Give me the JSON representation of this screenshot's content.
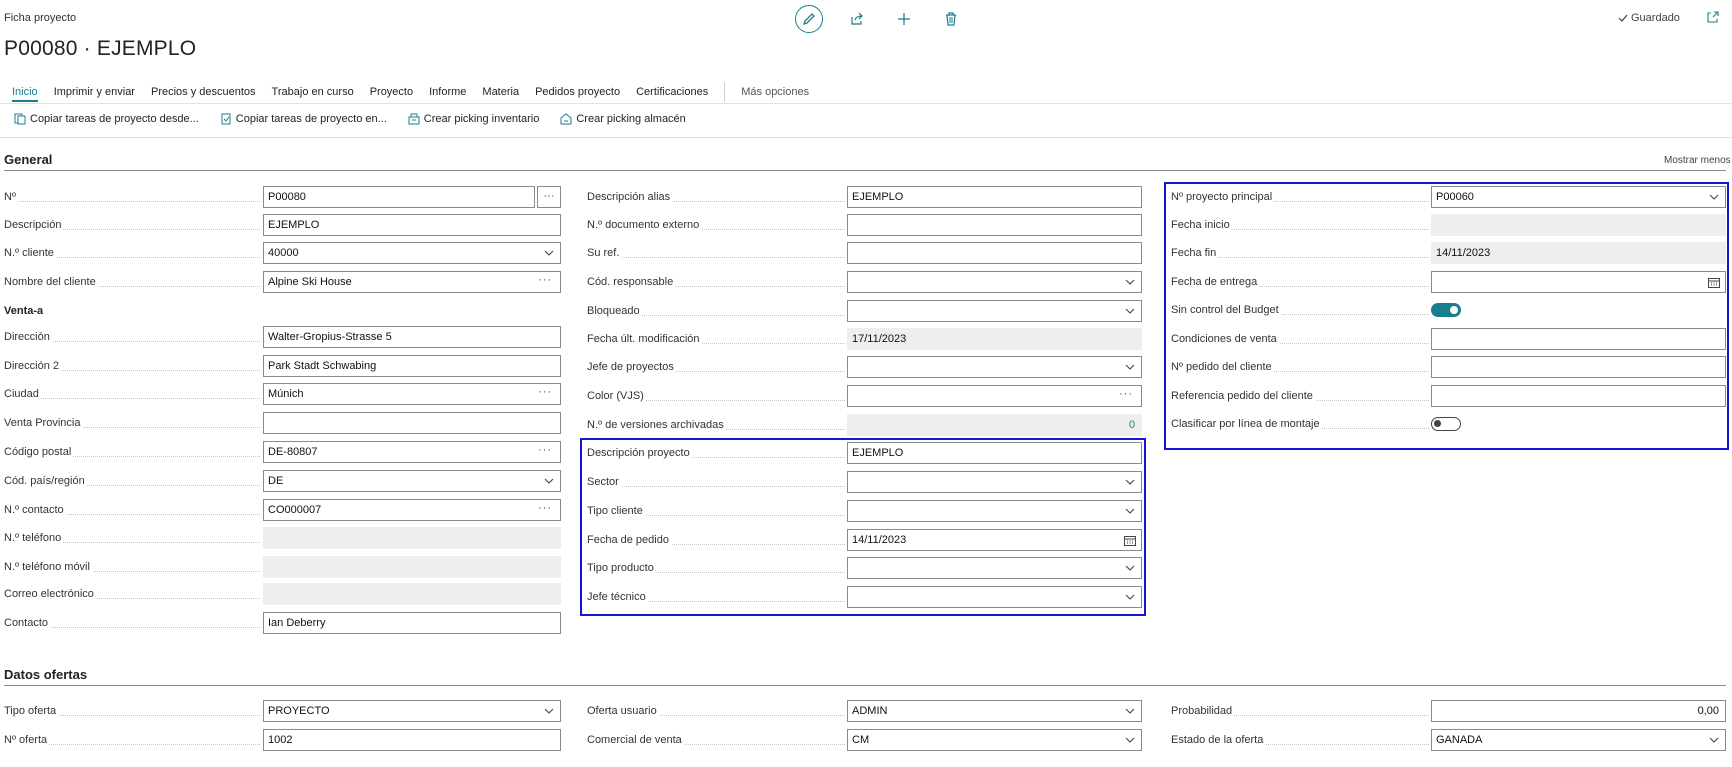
{
  "page": {
    "caption": "Ficha proyecto",
    "title": "P00080 · EJEMPLO",
    "saved": "Guardado"
  },
  "top_icons": [
    "edit-icon",
    "share-icon",
    "add-icon",
    "delete-icon"
  ],
  "tabs": [
    "Inicio",
    "Imprimir y enviar",
    "Precios y descuentos",
    "Trabajo en curso",
    "Proyecto",
    "Informe",
    "Materia",
    "Pedidos proyecto",
    "Certificaciones"
  ],
  "more_options": "Más opciones",
  "actions": [
    "Copiar tareas de proyecto desde...",
    "Copiar tareas de proyecto en...",
    "Crear picking inventario",
    "Crear picking almacén"
  ],
  "general": {
    "title": "General",
    "show_less": "Mostrar menos",
    "col1": {
      "no_label": "Nº",
      "no_value": "P00080",
      "descripcion_label": "Descripción",
      "descripcion_value": "EJEMPLO",
      "cliente_label": "N.º cliente",
      "cliente_value": "40000",
      "nombre_label": "Nombre del cliente",
      "nombre_value": "Alpine Ski House",
      "venta_a": "Venta-a",
      "direccion_label": "Dirección",
      "direccion_value": "Walter-Gropius-Strasse 5",
      "direccion2_label": "Dirección 2",
      "direccion2_value": "Park Stadt Schwabing",
      "ciudad_label": "Ciudad",
      "ciudad_value": "Múnich",
      "provincia_label": "Venta Provincia",
      "provincia_value": "",
      "cp_label": "Código postal",
      "cp_value": "DE-80807",
      "pais_label": "Cód. país/región",
      "pais_value": "DE",
      "contacto_no_label": "N.º contacto",
      "contacto_no_value": "CO000007",
      "telefono_label": "N.º teléfono",
      "telefono_value": "",
      "movil_label": "N.º teléfono móvil",
      "movil_value": "",
      "correo_label": "Correo electrónico",
      "correo_value": "",
      "contacto_label": "Contacto",
      "contacto_value": "Ian Deberry"
    },
    "col2": {
      "alias_label": "Descripción alias",
      "alias_value": "EJEMPLO",
      "docext_label": "N.º documento externo",
      "docext_value": "",
      "suref_label": "Su ref.",
      "suref_value": "",
      "responsable_label": "Cód. responsable",
      "responsable_value": "",
      "bloqueado_label": "Bloqueado",
      "bloqueado_value": "",
      "fechamod_label": "Fecha últ. modificación",
      "fechamod_value": "17/11/2023",
      "jefe_label": "Jefe de proyectos",
      "jefe_value": "",
      "color_label": "Color (VJS)",
      "color_value": "",
      "versiones_label": "N.º de versiones archivadas",
      "versiones_value": "0",
      "descproy_label": "Descripción proyecto",
      "descproy_value": "EJEMPLO",
      "sector_label": "Sector",
      "sector_value": "",
      "tipocliente_label": "Tipo cliente",
      "tipocliente_value": "",
      "fechapedido_label": "Fecha de pedido",
      "fechapedido_value": "14/11/2023",
      "tipoproducto_label": "Tipo producto",
      "tipoproducto_value": "",
      "jefetecnico_label": "Jefe técnico",
      "jefetecnico_value": ""
    },
    "col3": {
      "principal_label": "Nº proyecto principal",
      "principal_value": "P00060",
      "inicio_label": "Fecha inicio",
      "inicio_value": "",
      "fin_label": "Fecha fin",
      "fin_value": "14/11/2023",
      "entrega_label": "Fecha de entrega",
      "entrega_value": "",
      "budget_label": "Sin control del Budget",
      "budget_on": true,
      "condiciones_label": "Condiciones de venta",
      "condiciones_value": "",
      "pedidocliente_label": "Nº pedido del cliente",
      "pedidocliente_value": "",
      "refpedido_label": "Referencia pedido del cliente",
      "refpedido_value": "",
      "clasificar_label": "Clasificar por línea de montaje",
      "clasificar_on": false
    }
  },
  "ofertas": {
    "title": "Datos ofertas",
    "tipo_label": "Tipo oferta",
    "tipo_value": "PROYECTO",
    "numero_label": "Nº oferta",
    "numero_value": "1002",
    "usuario_label": "Oferta usuario",
    "usuario_value": "ADMIN",
    "comercial_label": "Comercial de venta",
    "comercial_value": "CM",
    "probabilidad_label": "Probabilidad",
    "probabilidad_value": "0,00",
    "estado_label": "Estado de la oferta",
    "estado_value": "GANADA"
  },
  "colors": {
    "accent": "#1a7f8c",
    "highlight": "#1515d6"
  }
}
